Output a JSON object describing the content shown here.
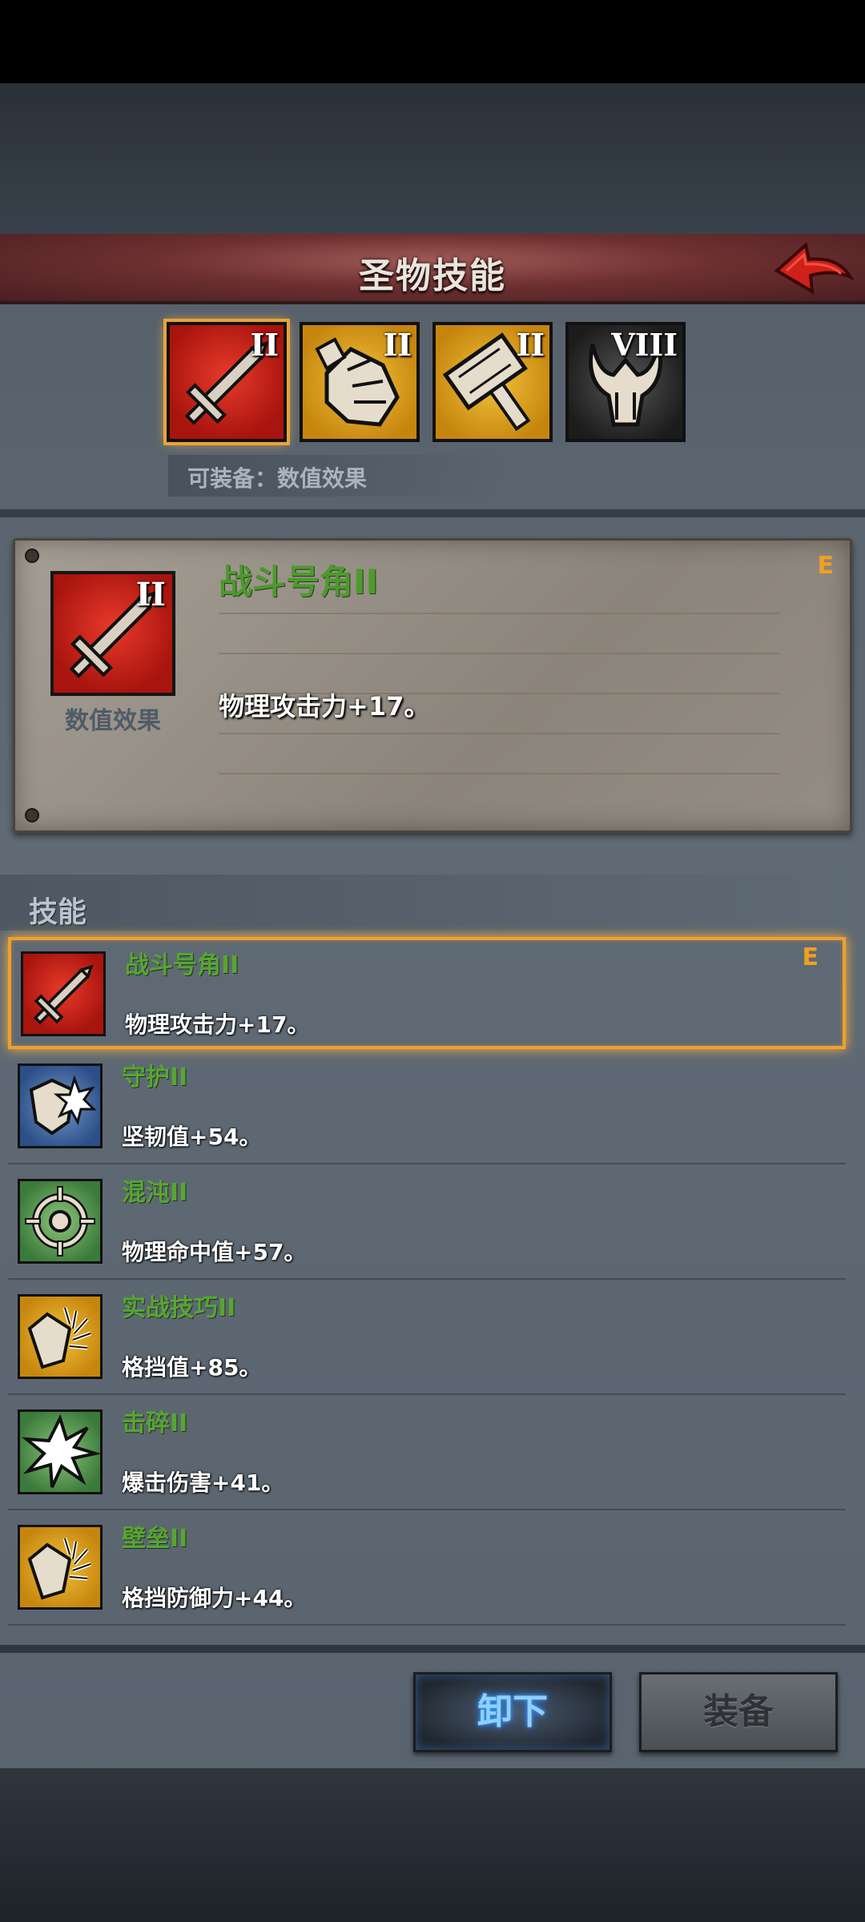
{
  "header": {
    "title": "圣物技能"
  },
  "relics": [
    {
      "icon": "sword-icon",
      "rank": "II",
      "color": "#c8221a",
      "selected": true
    },
    {
      "icon": "gauntlet-icon",
      "rank": "II",
      "color": "#d89a1c",
      "selected": false
    },
    {
      "icon": "hammer-icon",
      "rank": "II",
      "color": "#d89a1c",
      "selected": false
    },
    {
      "icon": "horned-helm-icon",
      "rank": "VIII",
      "color": "#333333",
      "selected": false
    }
  ],
  "equip_hint": "可装备：数值效果",
  "detail": {
    "rank": "II",
    "icon_label": "数值效果",
    "title": "战斗号角II",
    "description": "物理攻击力+17。",
    "grade": "E"
  },
  "skills_heading": "技能",
  "skills": [
    {
      "name": "战斗号角II",
      "desc": "物理攻击力+17。",
      "grade": "E",
      "icon": "sword-icon",
      "color": "#c8221a",
      "selected": true
    },
    {
      "name": "守护II",
      "desc": "坚韧值+54。",
      "grade": "",
      "icon": "shield-burst-icon",
      "color": "#2c4f88",
      "selected": false
    },
    {
      "name": "混沌II",
      "desc": "物理命中值+57。",
      "grade": "",
      "icon": "crosshair-icon",
      "color": "#3a7a3a",
      "selected": false
    },
    {
      "name": "实战技巧II",
      "desc": "格挡值+85。",
      "grade": "",
      "icon": "shield-strike-icon",
      "color": "#c6860e",
      "selected": false
    },
    {
      "name": "击碎II",
      "desc": "爆击伤害+41。",
      "grade": "",
      "icon": "starburst-icon",
      "color": "#3a7a3a",
      "selected": false
    },
    {
      "name": "壁垒II",
      "desc": "格挡防御力+44。",
      "grade": "",
      "icon": "shield-strike-icon",
      "color": "#c6860e",
      "selected": false
    }
  ],
  "buttons": {
    "unequip": "卸下",
    "equip": "装备"
  },
  "colors": {
    "skill_name": "#57a532",
    "grade": "#f0a020",
    "selection": "#f0a02c",
    "header": "#6e3030"
  }
}
